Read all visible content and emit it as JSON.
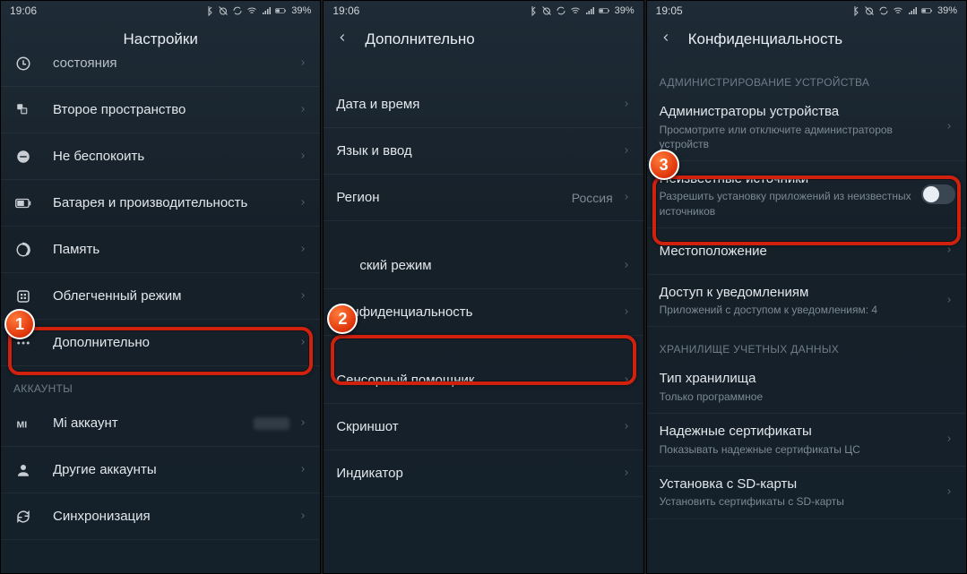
{
  "status": {
    "time1": "19:06",
    "time2": "19:06",
    "time3": "19:05",
    "battery": "39%"
  },
  "screens": [
    {
      "title": "Настройки",
      "has_back": false,
      "items": [
        {
          "type": "row",
          "icon": "schedule",
          "label": "состояния",
          "cut_top": true
        },
        {
          "type": "row",
          "icon": "second-space",
          "label": "Второе пространство"
        },
        {
          "type": "row",
          "icon": "dnd",
          "label": "Не беспокоить"
        },
        {
          "type": "row",
          "icon": "battery",
          "label": "Батарея и производительность"
        },
        {
          "type": "row",
          "icon": "memory",
          "label": "Память"
        },
        {
          "type": "row",
          "icon": "lite",
          "label": "Облегченный режим"
        },
        {
          "type": "row",
          "icon": "more",
          "label": "Дополнительно",
          "highlighted": true,
          "badge": "1"
        },
        {
          "type": "section",
          "label": "АККАУНТЫ"
        },
        {
          "type": "row",
          "icon": "mi",
          "label": "Mi аккаунт",
          "blur_value": true
        },
        {
          "type": "row",
          "icon": "person",
          "label": "Другие аккаунты"
        },
        {
          "type": "row",
          "icon": "sync",
          "label": "Синхронизация"
        }
      ]
    },
    {
      "title": "Дополнительно",
      "has_back": true,
      "items": [
        {
          "type": "spacer"
        },
        {
          "type": "row",
          "label": "Дата и время"
        },
        {
          "type": "row",
          "label": "Язык и ввод"
        },
        {
          "type": "row",
          "label": "Регион",
          "value": "Россия"
        },
        {
          "type": "spacer"
        },
        {
          "type": "row",
          "label": "ский режим",
          "partial_left": true
        },
        {
          "type": "row",
          "label": "Конфиденциальность",
          "highlighted": true,
          "badge": "2"
        },
        {
          "type": "spacer"
        },
        {
          "type": "row",
          "label": "Сенсорный помощник"
        },
        {
          "type": "row",
          "label": "Скриншот"
        },
        {
          "type": "row",
          "label": "Индикатор"
        }
      ]
    },
    {
      "title": "Конфиденциальность",
      "has_back": true,
      "items": [
        {
          "type": "section",
          "label": "АДМИНИСТРИРОВАНИЕ УСТРОЙСТВА"
        },
        {
          "type": "row",
          "label": "Администраторы устройства",
          "sublabel": "Просмотрите или отключите администраторов устройств"
        },
        {
          "type": "row",
          "label": "Неизвестные источники",
          "sublabel": "Разрешить установку приложений из неизвестных источников",
          "toggle": true,
          "highlighted": true,
          "badge": "3"
        },
        {
          "type": "row",
          "label": "Местоположение"
        },
        {
          "type": "row",
          "label": "Доступ к уведомлениям",
          "sublabel": "Приложений с доступом к уведомлениям: 4"
        },
        {
          "type": "section",
          "label": "ХРАНИЛИЩЕ УЧЕТНЫХ ДАННЫХ"
        },
        {
          "type": "row",
          "label": "Тип хранилища",
          "sublabel": "Только программное"
        },
        {
          "type": "row",
          "label": "Надежные сертификаты",
          "sublabel": "Показывать надежные сертификаты ЦС"
        },
        {
          "type": "row",
          "label": "Установка с SD-карты",
          "sublabel": "Установить сертификаты с SD-карты"
        }
      ]
    }
  ],
  "badges": {
    "1": "1",
    "2": "2",
    "3": "3"
  }
}
